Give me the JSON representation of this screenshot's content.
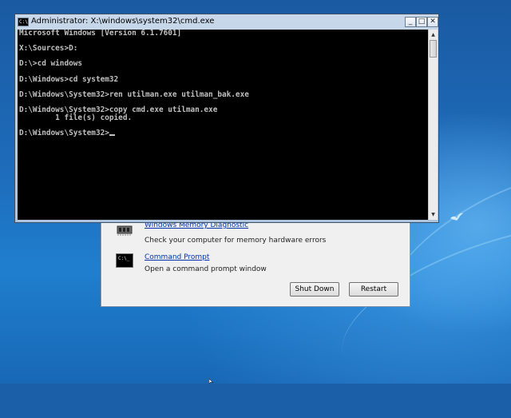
{
  "window": {
    "title": "Administrator: X:\\windows\\system32\\cmd.exe",
    "icon_text": "C:\\",
    "minimize_glyph": "_",
    "maximize_glyph": "□",
    "close_glyph": "✕"
  },
  "console": {
    "lines": [
      "Microsoft Windows [Version 6.1.7601]",
      "",
      "X:\\Sources>D:",
      "",
      "D:\\>cd windows",
      "",
      "D:\\Windows>cd system32",
      "",
      "D:\\Windows\\System32>ren utilman.exe utilman_bak.exe",
      "",
      "D:\\Windows\\System32>copy cmd.exe utilman.exe",
      "        1 file(s) copied.",
      "",
      "D:\\Windows\\System32>"
    ]
  },
  "scrollbar": {
    "up_glyph": "▲",
    "down_glyph": "▼"
  },
  "recovery": {
    "items": [
      {
        "title": "Windows Memory Diagnostic",
        "description": "Check your computer for memory hardware errors",
        "icon": "memory-chip-icon"
      },
      {
        "title": "Command Prompt",
        "description": "Open a command prompt window",
        "icon": "command-prompt-icon"
      }
    ],
    "shutdown_label": "Shut Down",
    "restart_label": "Restart"
  },
  "colors": {
    "console_bg": "#000000",
    "console_text": "#c0c0c0",
    "link": "#0033aa"
  }
}
